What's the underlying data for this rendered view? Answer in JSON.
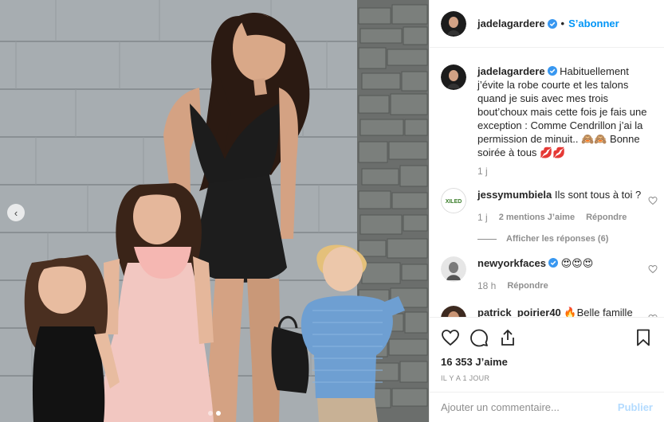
{
  "header": {
    "username": "jadelagardere",
    "separator": "•",
    "follow_label": "S’abonner"
  },
  "caption": {
    "username": "jadelagardere",
    "text": "Habituellement j’évite la robe courte et les talons quand je suis avec mes trois bout’choux mais cette fois je fais une exception : Comme Cendrillon j’ai la permission de minuit.. 🙈🙈 Bonne soirée à tous 💋💋",
    "time": "1 j"
  },
  "comments": [
    {
      "username": "jessymumbiela",
      "text": "Ils sont tous à toi ?",
      "time": "1 j",
      "likes": "2 mentions J’aime",
      "reply_label": "Répondre",
      "avatar_text": "XILED",
      "replies_label": "Afficher les réponses (6)"
    },
    {
      "username": "newyorkfaces",
      "text": "😍😍😍",
      "time": "18 h",
      "reply_label": "Répondre"
    },
    {
      "username": "patrick_poirier40",
      "text": "🔥Belle famille"
    }
  ],
  "actions": {
    "likes": "16 353 J’aime",
    "date": "Il y a 1 jour"
  },
  "add_comment": {
    "placeholder": "Ajouter un commentaire...",
    "publish_label": "Publier"
  },
  "colors": {
    "link_blue": "#0095f6",
    "verified_blue": "#3897f0",
    "muted_text": "#8e8e8e",
    "publish_disabled": "#b3dbff"
  },
  "icons": {
    "prev": "chevron-left-icon",
    "like": "heart-icon",
    "comment": "comment-bubble-icon",
    "share": "share-icon",
    "save": "bookmark-icon",
    "verified": "verified-badge-icon"
  },
  "carousel": {
    "total": 2,
    "active": 2
  }
}
